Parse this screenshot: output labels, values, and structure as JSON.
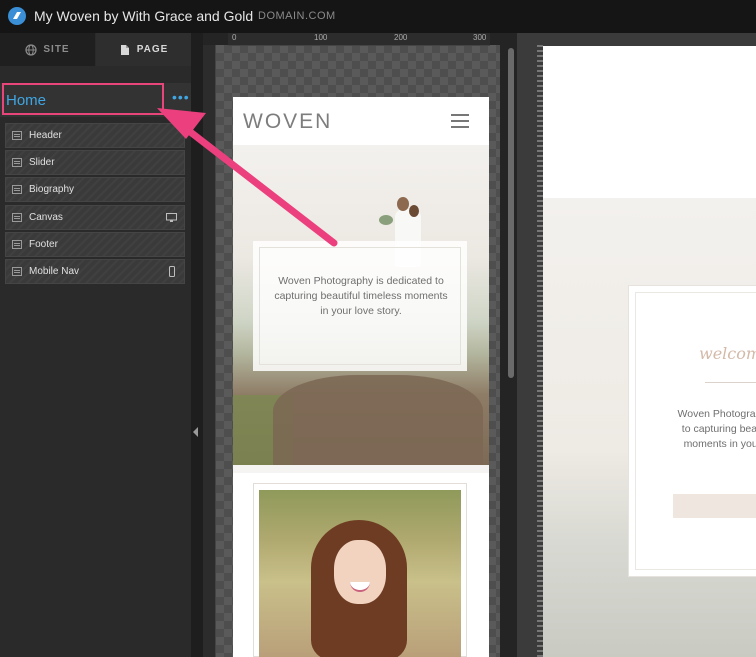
{
  "app": {
    "site_title": "My Woven by With Grace and Gold",
    "domain": "DOMAIN.COM"
  },
  "sidebar": {
    "tabs": [
      {
        "label": "SITE",
        "icon": "globe-icon",
        "active": false
      },
      {
        "label": "PAGE",
        "icon": "page-icon",
        "active": true
      }
    ],
    "current_page": "Home",
    "more_label": "•••",
    "sections": [
      {
        "label": "Header",
        "device": ""
      },
      {
        "label": "Slider",
        "device": ""
      },
      {
        "label": "Biography",
        "device": ""
      },
      {
        "label": "Canvas",
        "device": "desktop-icon"
      },
      {
        "label": "Footer",
        "device": ""
      },
      {
        "label": "Mobile Nav",
        "device": "mobile-icon"
      }
    ],
    "highlight_color": "#e8457a",
    "accent_color": "#3fa6e3"
  },
  "ruler": {
    "ticks": [
      "0",
      "100",
      "200",
      "300"
    ]
  },
  "mobile_preview": {
    "brand": "WOVEN",
    "hero_text": "Woven Photography is dedicated to capturing beautiful timeless moments in your love story."
  },
  "desktop_preview": {
    "welcome": "welcom",
    "text_lines": [
      "Woven Photography",
      "to capturing beauti",
      "moments in your l"
    ]
  }
}
